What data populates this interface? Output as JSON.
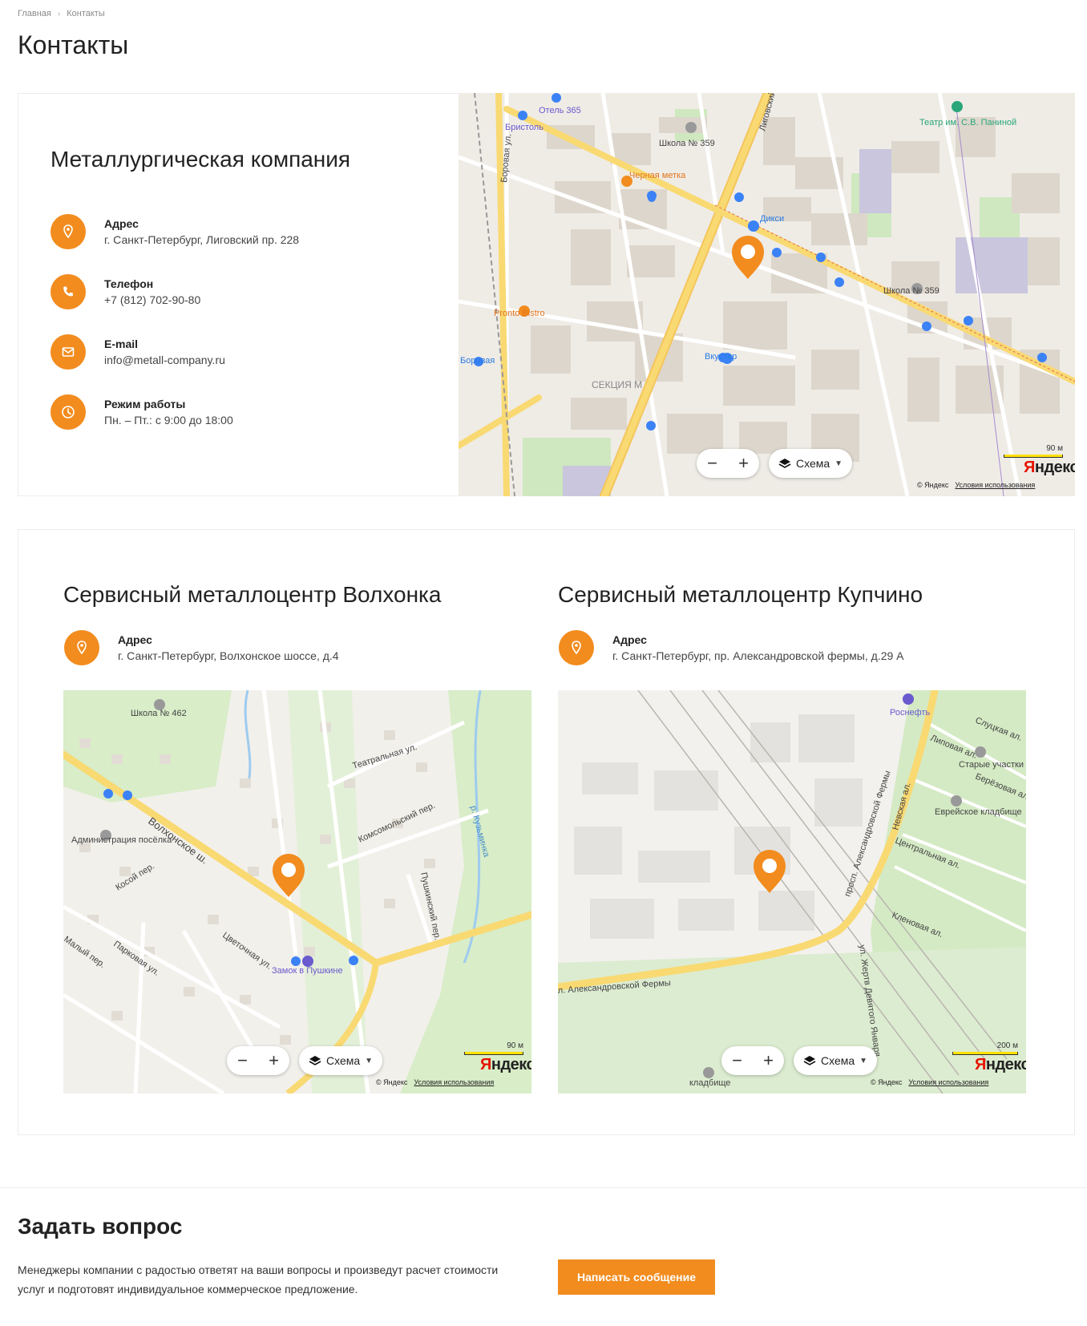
{
  "breadcrumb": {
    "home": "Главная",
    "current": "Контакты"
  },
  "page_title": "Контакты",
  "company": {
    "title": "Металлургическая компания",
    "rows": [
      {
        "icon": "location-pin-icon",
        "label": "Адрес",
        "value": "г. Санкт-Петербург, Лиговский пр. 228"
      },
      {
        "icon": "phone-icon",
        "label": "Телефон",
        "value": "+7 (812) 702-90-80"
      },
      {
        "icon": "mail-icon",
        "label": "E-mail",
        "value": "info@metall-company.ru"
      },
      {
        "icon": "clock-icon",
        "label": "Режим работы",
        "value": "Пн. – Пт.: с 9:00 до 18:00"
      }
    ]
  },
  "maps": {
    "main": {
      "scale": "90 м",
      "labels": [
        "Отель 365",
        "Бристоль",
        "Школа № 359",
        "Черная метка",
        "Дикси",
        "Pronto Bistro",
        "Вкустер",
        "Боровая",
        "Боровая ул.",
        "Лиговский",
        "СЕКЦИЯ М",
        "Театр им. С.В. Паниной",
        "Школа № 359"
      ]
    },
    "volkhonka": {
      "scale": "90 м",
      "labels": [
        "Школа № 462",
        "Администрация посёлка",
        "Волхонское ш.",
        "Театральная ул.",
        "Комсомольский пер.",
        "р. Кузьминка",
        "Пушкинский пер.",
        "Замок в Пушкине",
        "Парковая ул.",
        "Цветочная ул.",
        "Косой пер.",
        "Малый пер."
      ]
    },
    "kupchino": {
      "scale": "200 м",
      "labels": [
        "Роснефть",
        "Слуцкая ал.",
        "Липовая ал.",
        "Старые участки",
        "Берёзовая ал.",
        "Еврейское кладбище",
        "Невская ал.",
        "Центральная ал.",
        "Кленовая ал.",
        "просп. Александровской Фермы",
        "ул. Жертв Девятого Января",
        "кладбище",
        "л. Александровской Фермы"
      ]
    },
    "controls": {
      "zoom_out": "−",
      "zoom_in": "+",
      "layer": "Схема",
      "copyright": "© Яндекс",
      "terms": "Условия использования",
      "logo_first": "Я",
      "logo_rest": "ндекс"
    }
  },
  "branches": [
    {
      "title": "Сервисный металлоцентр Волхонка",
      "label": "Адрес",
      "value": "г. Санкт-Петербург, Волхонское шоссе, д.4"
    },
    {
      "title": "Сервисный металлоцентр Купчино",
      "label": "Адрес",
      "value": "г. Санкт-Петербург, пр. Александровской фермы, д.29 А"
    }
  ],
  "ask": {
    "title": "Задать вопрос",
    "text": "Менеджеры компании с радостью ответят на ваши вопросы и произведут расчет стоимости услуг и подготовят индивидуальное коммерческое предложение.",
    "button": "Написать сообщение"
  },
  "colors": {
    "accent": "#f28c1e",
    "road": "#f9d972",
    "park": "#cfe8c0",
    "building": "#ddd6cc"
  }
}
